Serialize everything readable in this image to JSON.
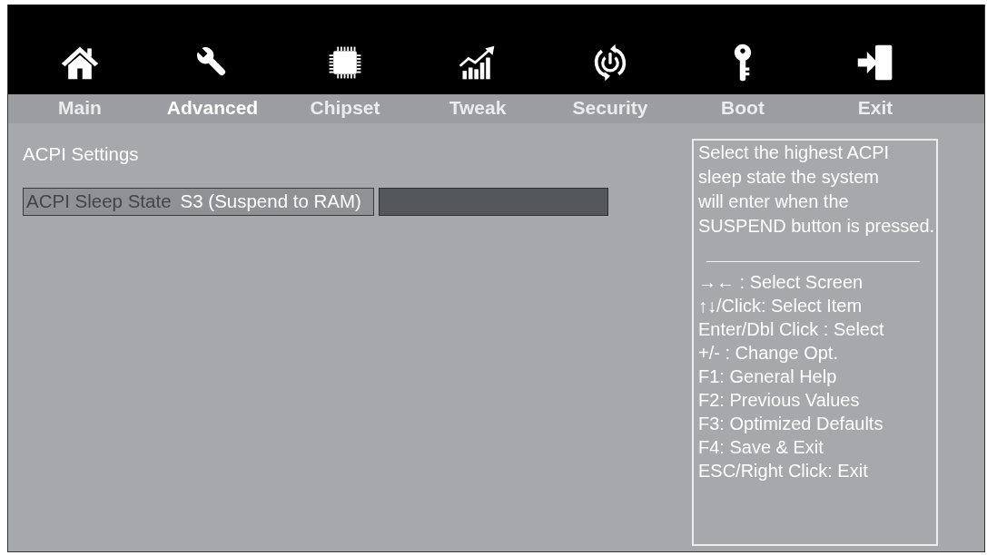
{
  "tabs": [
    {
      "label": "Main",
      "selected": false
    },
    {
      "label": "Advanced",
      "selected": true
    },
    {
      "label": "Chipset",
      "selected": false
    },
    {
      "label": "Tweak",
      "selected": false
    },
    {
      "label": "Security",
      "selected": false
    },
    {
      "label": "Boot",
      "selected": false
    },
    {
      "label": "Exit",
      "selected": false
    }
  ],
  "section_title": "ACPI Settings",
  "settings": [
    {
      "label": "ACPI Sleep State",
      "value": "S3 (Suspend to RAM)",
      "selected": true
    }
  ],
  "help": {
    "description": "Select the highest ACPI\nsleep state the system\nwill enter when the\nSUSPEND button is pressed.",
    "keys": [
      "→← : Select Screen",
      "↑↓/Click: Select Item",
      "Enter/Dbl Click : Select",
      "+/- : Change Opt.",
      "F1: General Help",
      "F2: Previous Values",
      "F3: Optimized Defaults",
      "F4: Save & Exit",
      "ESC/Right Click: Exit"
    ]
  }
}
